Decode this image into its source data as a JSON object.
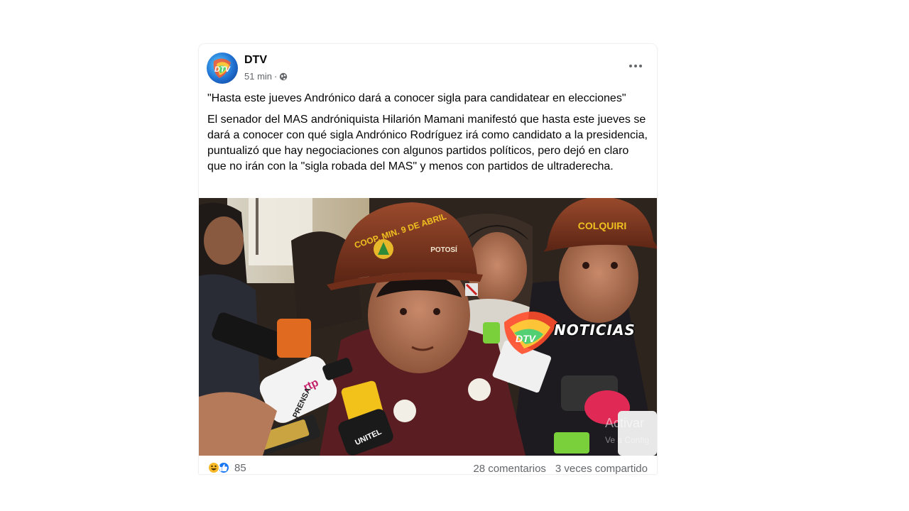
{
  "post": {
    "page_name": "DTV",
    "time": "51 min",
    "separator": "·",
    "privacy_icon": "globe-icon",
    "more_icon": "more-horizontal-icon",
    "headline": "\"Hasta este jueves Andrónico dará a conocer sigla para candidatear en elecciones\"",
    "body": "El senador del MAS andróniquista Hilarión Mamani manifestó que hasta este jueves se dará a conocer con qué sigla Andrónico Rodríguez irá como candidato a la presidencia, puntualizó que hay negociaciones con algunos partidos políticos, pero dejó en claro que no irán con la \"sigla robada del MAS\" y menos con partidos de ultraderecha."
  },
  "photo": {
    "helmet_left_text": "COOP. MIN. 9 DE ABRIL",
    "helmet_left_side": "POTOSÍ",
    "helmet_right_text": "COLQUIRI",
    "logo_text": "DTV",
    "bug_text": "NOTICIAS",
    "mic_rtp": "rtp",
    "mic_prensa": "PRENSA",
    "mic_unitel": "UNITEL",
    "watermark_line1": "Activar",
    "watermark_line2": "Ve a Config"
  },
  "footer": {
    "reaction_icons": [
      "haha-icon",
      "like-icon"
    ],
    "reaction_count": "85",
    "comments": "28 comentarios",
    "shares": "3 veces compartido"
  },
  "colors": {
    "text_primary": "#050505",
    "text_secondary": "#65676b",
    "like_blue": "#1877f2",
    "haha_yellow": "#f7b928"
  }
}
